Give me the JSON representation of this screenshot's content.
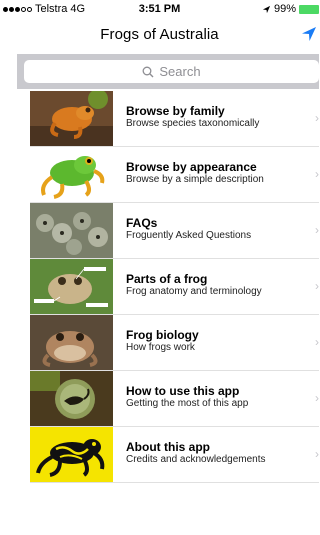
{
  "status_bar": {
    "carrier": "Telstra",
    "network": "4G",
    "time": "3:51 PM",
    "battery": "99%",
    "battery_color": "#4cd964"
  },
  "nav": {
    "title": "Frogs of Australia",
    "location_icon": "location-arrow-icon",
    "accent_color": "#1a7cf5"
  },
  "search": {
    "placeholder": "Search",
    "icon": "search-icon"
  },
  "menu": [
    {
      "title": "Browse by family",
      "subtitle": "Browse species taxonomically",
      "thumb": "orange-frog-photo"
    },
    {
      "title": "Browse by appearance",
      "subtitle": "Browse by a simple description",
      "thumb": "green-tree-frog-illustration"
    },
    {
      "title": "FAQs",
      "subtitle": "Froguently Asked Questions",
      "thumb": "frog-eggs-photo"
    },
    {
      "title": "Parts of a frog",
      "subtitle": "Frog anatomy and terminology",
      "thumb": "annotated-frog-photo"
    },
    {
      "title": "Frog biology",
      "subtitle": "How frogs work",
      "thumb": "brown-frog-photo"
    },
    {
      "title": "How to use this app",
      "subtitle": "Getting the most of this app",
      "thumb": "tadpole-in-egg-photo"
    },
    {
      "title": "About this app",
      "subtitle": "Credits and acknowledgements",
      "thumb": "yellow-black-frog-logo"
    }
  ]
}
